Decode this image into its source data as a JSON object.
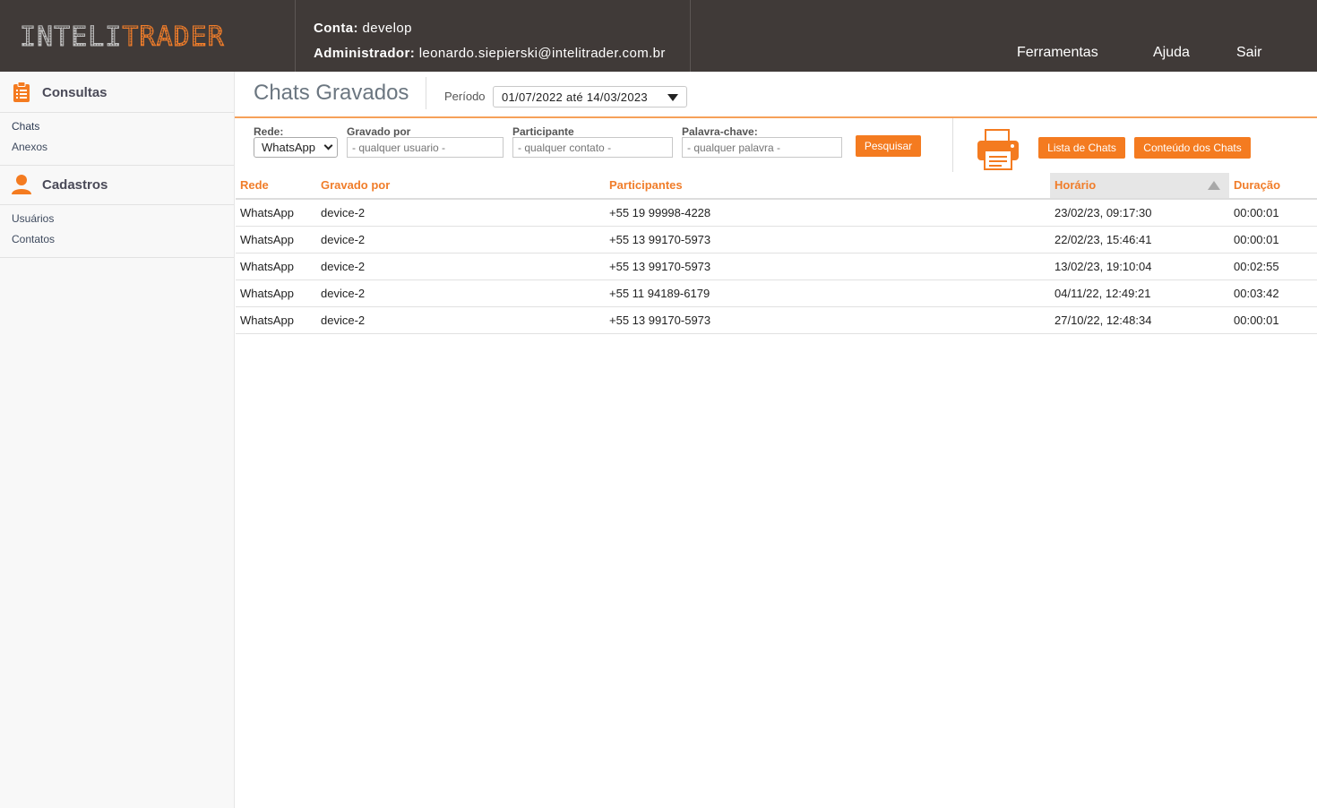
{
  "header": {
    "logo_part1": "INTELI",
    "logo_part2": "TRADER",
    "account_label": "Conta:",
    "account_value": "develop",
    "admin_label": "Administrador:",
    "admin_value": "leonardo.siepierski@intelitrader.com.br",
    "nav": [
      "Ferramentas",
      "Ajuda",
      "Sair"
    ]
  },
  "sidebar": {
    "sections": [
      {
        "title": "Consultas",
        "icon": "clipboard-icon",
        "items": [
          "Chats",
          "Anexos"
        ]
      },
      {
        "title": "Cadastros",
        "icon": "user-icon",
        "items": [
          "Usuários",
          "Contatos"
        ]
      }
    ]
  },
  "main": {
    "title": "Chats Gravados",
    "periodo_label": "Período",
    "periodo_value": "01/07/2022 até 14/03/2023"
  },
  "filters": {
    "rede_label": "Rede:",
    "rede_value": "WhatsApp",
    "gravado_label": "Gravado por",
    "gravado_placeholder": "- qualquer usuario -",
    "participante_label": "Participante",
    "participante_placeholder": "- qualquer contato -",
    "palavra_label": "Palavra-chave:",
    "palavra_placeholder": "- qualquer palavra -",
    "search_button": "Pesquisar",
    "print_icon": "printer-icon",
    "lista_button": "Lista de Chats",
    "conteudo_button": "Conteúdo dos Chats"
  },
  "table": {
    "headers": [
      "Rede",
      "Gravado por",
      "Participantes",
      "Horário",
      "Duração"
    ],
    "sorted_column": "Horário",
    "rows": [
      [
        "WhatsApp",
        "device-2",
        "+55 19 99998-4228",
        "23/02/23, 09:17:30",
        "00:00:01"
      ],
      [
        "WhatsApp",
        "device-2",
        "+55 13 99170-5973",
        "22/02/23, 15:46:41",
        "00:00:01"
      ],
      [
        "WhatsApp",
        "device-2",
        "+55 13 99170-5973",
        "13/02/23, 19:10:04",
        "00:02:55"
      ],
      [
        "WhatsApp",
        "device-2",
        "+55 11 94189-6179",
        "04/11/22, 12:49:21",
        "00:03:42"
      ],
      [
        "WhatsApp",
        "device-2",
        "+55 13 99170-5973",
        "27/10/22, 12:48:34",
        "00:00:01"
      ]
    ]
  },
  "colors": {
    "header_bg": "#403a38",
    "accent": "#f47b20",
    "header_text": "#f07d2a"
  }
}
